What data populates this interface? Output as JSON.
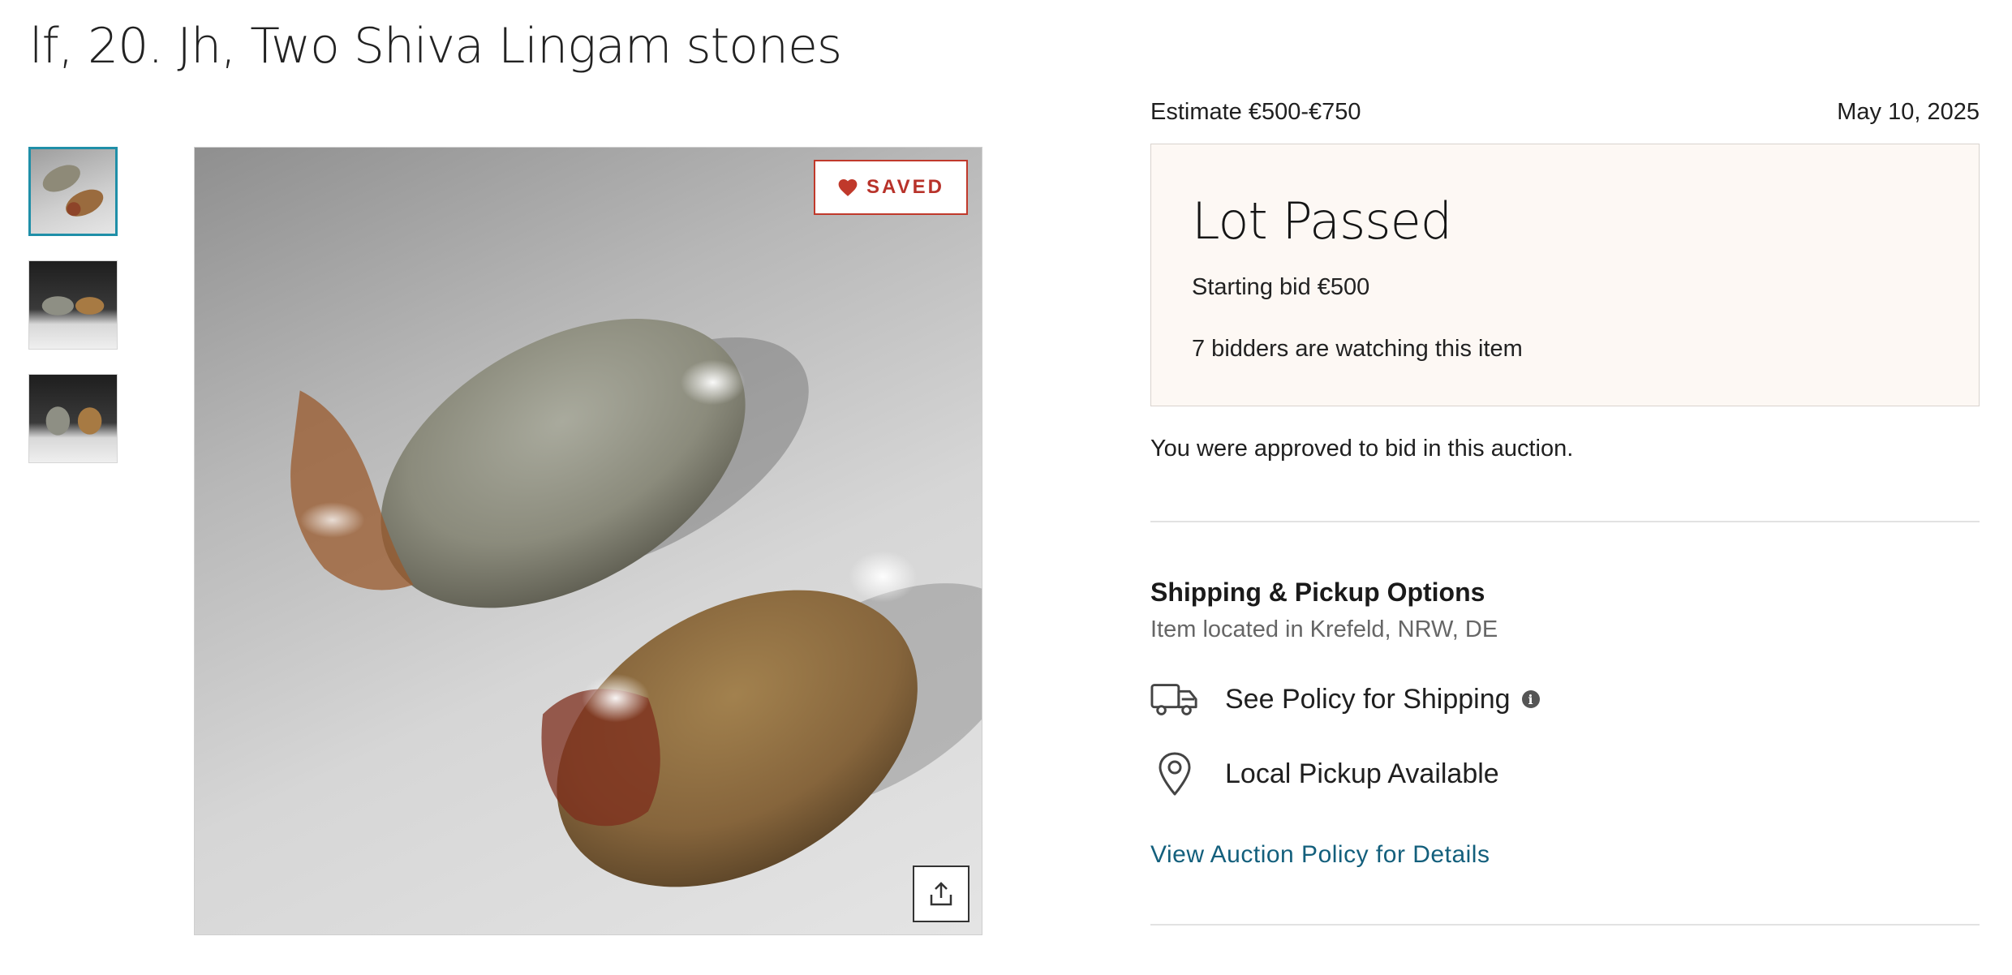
{
  "lot": {
    "title": "lf, 20. Jh, Two Shiva Lingam stones"
  },
  "gallery": {
    "thumbnails": [
      {
        "alt": "thumbnail-1",
        "active": true
      },
      {
        "alt": "thumbnail-2",
        "active": false
      },
      {
        "alt": "thumbnail-3",
        "active": false
      }
    ],
    "saved_label": "SAVED",
    "saved_icon": "heart-icon",
    "share_icon": "share-icon"
  },
  "auction": {
    "estimate": "Estimate €500-€750",
    "date": "May 10, 2025",
    "status": "Lot Passed",
    "starting_bid": "Starting bid €500",
    "watchers": "7 bidders are watching this item",
    "approved_text": "You were approved to bid in this auction."
  },
  "shipping": {
    "heading": "Shipping & Pickup Options",
    "location": "Item located in Krefeld, NRW, DE",
    "options": [
      {
        "icon": "truck-icon",
        "label": "See Policy for Shipping",
        "info_icon": "info-icon"
      },
      {
        "icon": "location-pin-icon",
        "label": "Local Pickup Available"
      }
    ],
    "policy_link": "View Auction Policy for Details"
  },
  "colors": {
    "accent_teal": "#1f8fa8",
    "saved_red": "#c0392b",
    "link": "#135f7c",
    "status_box_bg": "#fdf8f4"
  }
}
